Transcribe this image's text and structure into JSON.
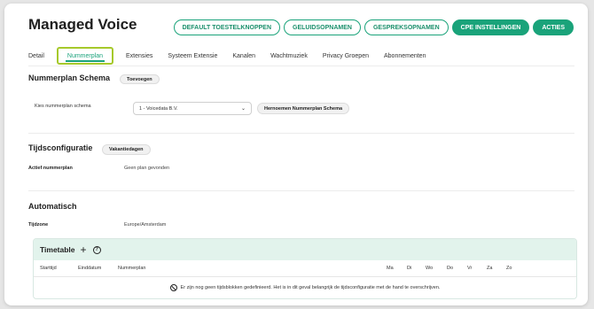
{
  "page": {
    "title": "Managed Voice"
  },
  "top_buttons": [
    {
      "label": "DEFAULT TOESTELKNOPPEN",
      "style": "outline"
    },
    {
      "label": "GELUIDSOPNAMEN",
      "style": "outline"
    },
    {
      "label": "GESPREKSOPNAMEN",
      "style": "outline"
    },
    {
      "label": "CPE INSTELLINGEN",
      "style": "solid"
    },
    {
      "label": "ACTIES",
      "style": "solid"
    }
  ],
  "tabs": [
    {
      "label": "Detail",
      "active": false
    },
    {
      "label": "Nummerplan",
      "active": true
    },
    {
      "label": "Extensies",
      "active": false
    },
    {
      "label": "Systeem Extensie",
      "active": false
    },
    {
      "label": "Kanalen",
      "active": false
    },
    {
      "label": "Wachtmuziek",
      "active": false
    },
    {
      "label": "Privacy Groepen",
      "active": false
    },
    {
      "label": "Abonnementen",
      "active": false
    }
  ],
  "nummerplan": {
    "title": "Nummerplan Schema",
    "add_label": "Toevoegen",
    "field_label": "Kies nummerplan schema",
    "selected": "1 - Voicedata B.V.",
    "rename_label": "Hernoemen Nummerplan Schema"
  },
  "tijdsconfiguratie": {
    "title": "Tijdsconfiguratie",
    "holiday_label": "Vakantiedagen",
    "active_label": "Actief nummerplan",
    "active_value": "Geen plan gevonden"
  },
  "automatisch": {
    "title": "Automatisch",
    "timezone_label": "Tijdzone",
    "timezone_value": "Europe/Amsterdam"
  },
  "timetable": {
    "title": "Timetable",
    "plus": "+",
    "help": "?",
    "columns": {
      "start": "Starttijd",
      "end": "Einddatum",
      "plan": "Nummerplan",
      "ma": "Ma",
      "di": "Di",
      "wo": "Wo",
      "do": "Do",
      "vr": "Vr",
      "za": "Za",
      "zo": "Zo"
    },
    "empty_message": "Er zijn nog geen tijdsblokken gedefinieerd. Het is in dit geval belangrijk de tijdsconfiguratie met de hand te overschrijven."
  },
  "colors": {
    "accent": "#1aa37a",
    "active_tab_border": "#a6c92b",
    "timetable_header": "#e2f3ec"
  }
}
